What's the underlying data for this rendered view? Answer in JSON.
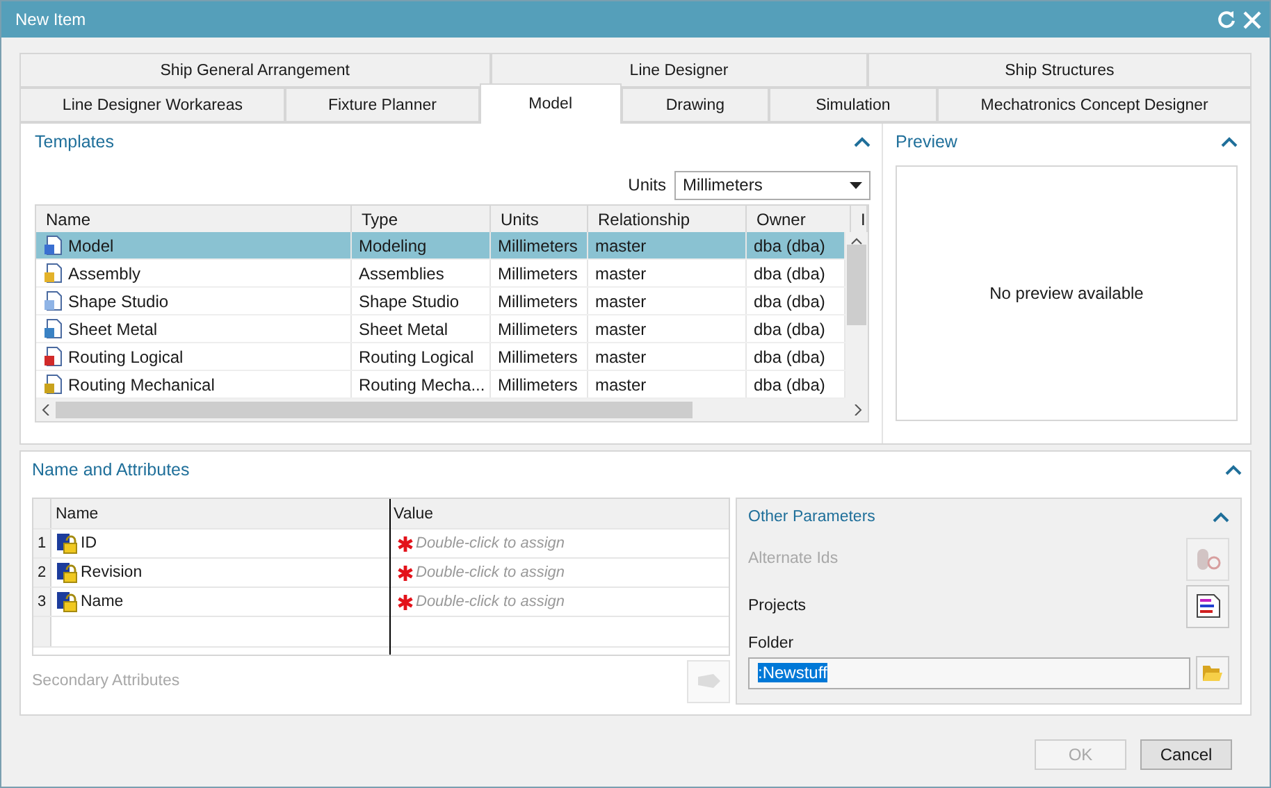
{
  "window": {
    "title": "New Item"
  },
  "tab_rows": [
    [
      {
        "label": "Ship General Arrangement",
        "selected": false
      },
      {
        "label": "Line Designer",
        "selected": false
      },
      {
        "label": "Ship Structures",
        "selected": false
      }
    ],
    [
      {
        "label": "Line Designer Workareas",
        "selected": false
      },
      {
        "label": "Fixture Planner",
        "selected": false
      },
      {
        "label": "Model",
        "selected": true
      },
      {
        "label": "Drawing",
        "selected": false
      },
      {
        "label": "Simulation",
        "selected": false
      },
      {
        "label": "Mechatronics Concept Designer",
        "selected": false
      }
    ]
  ],
  "templates": {
    "title": "Templates",
    "units_label": "Units",
    "units_value": "Millimeters",
    "columns": [
      "Name",
      "Type",
      "Units",
      "Relationship",
      "Owner",
      "I"
    ],
    "rows": [
      {
        "kind": "model",
        "cells": [
          "Model",
          "Modeling",
          "Millimeters",
          "master",
          "dba (dba)"
        ],
        "selected": true
      },
      {
        "kind": "assembly",
        "cells": [
          "Assembly",
          "Assemblies",
          "Millimeters",
          "master",
          "dba (dba)"
        ],
        "selected": false
      },
      {
        "kind": "shape",
        "cells": [
          "Shape Studio",
          "Shape Studio",
          "Millimeters",
          "master",
          "dba (dba)"
        ],
        "selected": false
      },
      {
        "kind": "sheet",
        "cells": [
          "Sheet Metal",
          "Sheet Metal",
          "Millimeters",
          "master",
          "dba (dba)"
        ],
        "selected": false
      },
      {
        "kind": "logical",
        "cells": [
          "Routing Logical",
          "Routing Logical",
          "Millimeters",
          "master",
          "dba (dba)"
        ],
        "selected": false
      },
      {
        "kind": "mechanical",
        "cells": [
          "Routing Mechanical",
          "Routing Mecha...",
          "Millimeters",
          "master",
          "dba (dba)"
        ],
        "selected": false
      }
    ]
  },
  "preview": {
    "title": "Preview",
    "message": "No preview available"
  },
  "attributes": {
    "title": "Name and Attributes",
    "columns": [
      "Name",
      "Value"
    ],
    "rows": [
      {
        "index": "1",
        "name": "ID",
        "hint": "Double-click to assign"
      },
      {
        "index": "2",
        "name": "Revision",
        "hint": "Double-click to assign"
      },
      {
        "index": "3",
        "name": "Name",
        "hint": "Double-click to assign"
      }
    ],
    "secondary": {
      "label": "Secondary Attributes",
      "disabled": true
    }
  },
  "other_parameters": {
    "title": "Other Parameters",
    "items": [
      {
        "label": "Alternate Ids",
        "disabled": true
      },
      {
        "label": "Projects",
        "disabled": false
      }
    ],
    "folder_label": "Folder",
    "folder_value": ":Newstuff",
    "folder_text_selected": true
  },
  "buttons": [
    {
      "label": "OK",
      "disabled": true
    },
    {
      "label": "Cancel",
      "disabled": false
    }
  ]
}
